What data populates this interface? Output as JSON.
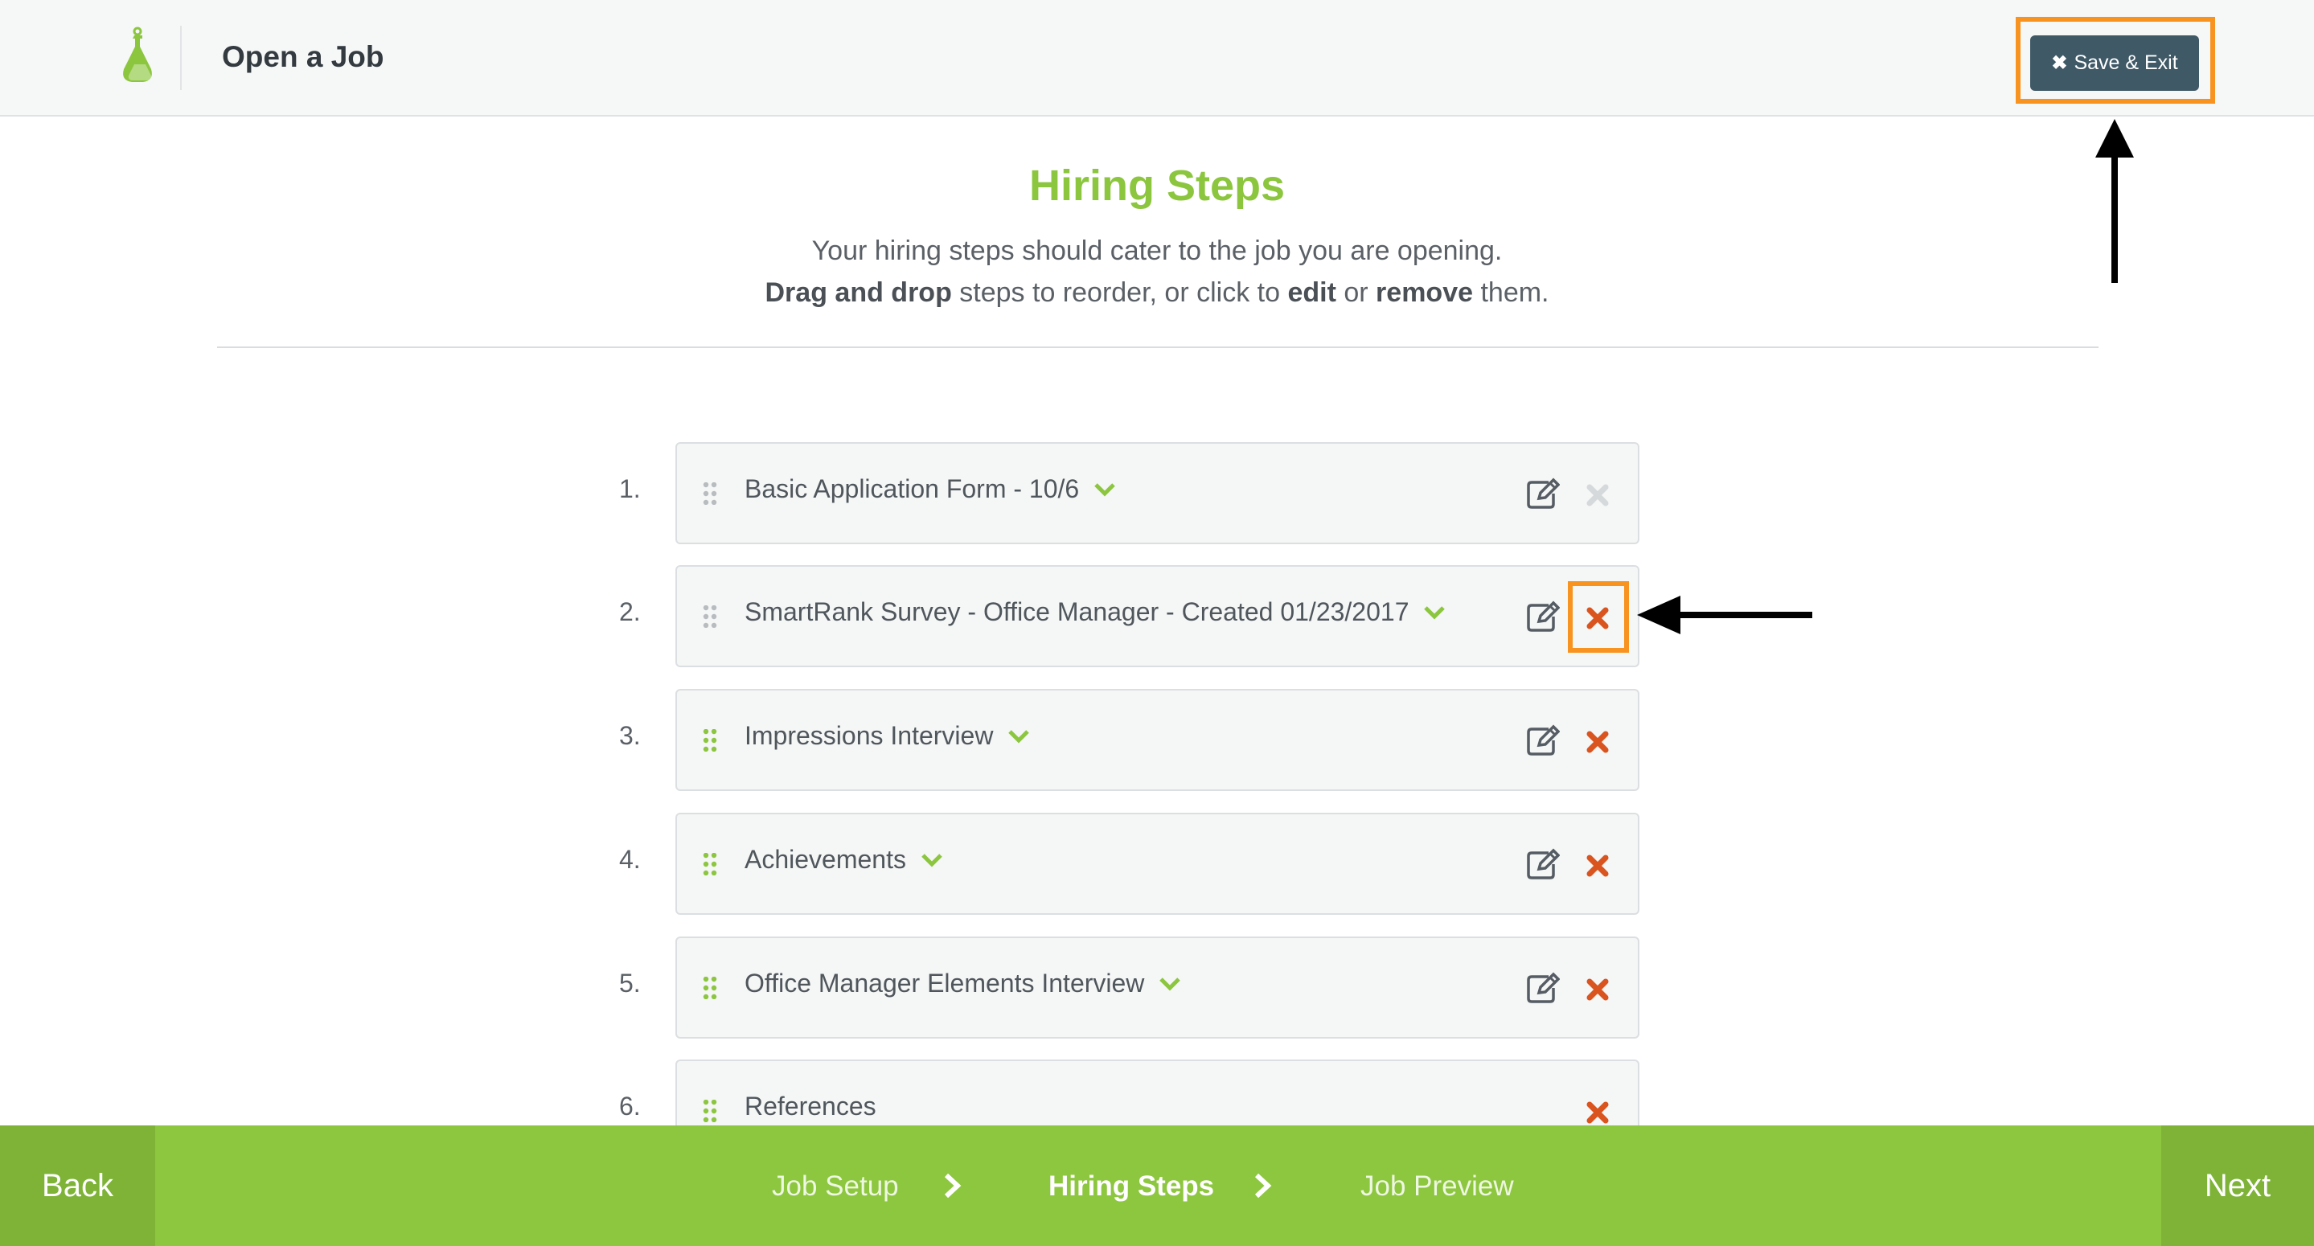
{
  "header": {
    "title": "Open a Job",
    "save_exit_label": "Save & Exit",
    "logo_icon": "flask-icon"
  },
  "intro": {
    "heading": "Hiring Steps",
    "line1": "Your hiring steps should cater to the job you are opening.",
    "line2_bold1": "Drag and drop",
    "line2_text1": " steps to reorder, or click to ",
    "line2_bold2": "edit",
    "line2_text2": " or ",
    "line2_bold3": "remove",
    "line2_text3": " them."
  },
  "steps": [
    {
      "num": "1.",
      "label": "Basic Application Form - 10/6",
      "editable": true,
      "removable": false
    },
    {
      "num": "2.",
      "label": "SmartRank Survey - Office Manager - Created 01/23/2017",
      "editable": true,
      "removable": true
    },
    {
      "num": "3.",
      "label": "Impressions Interview",
      "editable": true,
      "removable": true
    },
    {
      "num": "4.",
      "label": "Achievements",
      "editable": true,
      "removable": true
    },
    {
      "num": "5.",
      "label": "Office Manager Elements Interview",
      "editable": true,
      "removable": true
    },
    {
      "num": "6.",
      "label": "References",
      "editable": false,
      "removable": true
    }
  ],
  "footer": {
    "back_label": "Back",
    "next_label": "Next",
    "wizard_steps": [
      "Job Setup",
      "Hiring Steps",
      "Job Preview"
    ],
    "active_step": "Hiring Steps"
  },
  "colors": {
    "brand_green": "#8dc63f",
    "header_button": "#3f5966",
    "highlight_orange": "#f7931e",
    "remove_red": "#d9541e"
  }
}
